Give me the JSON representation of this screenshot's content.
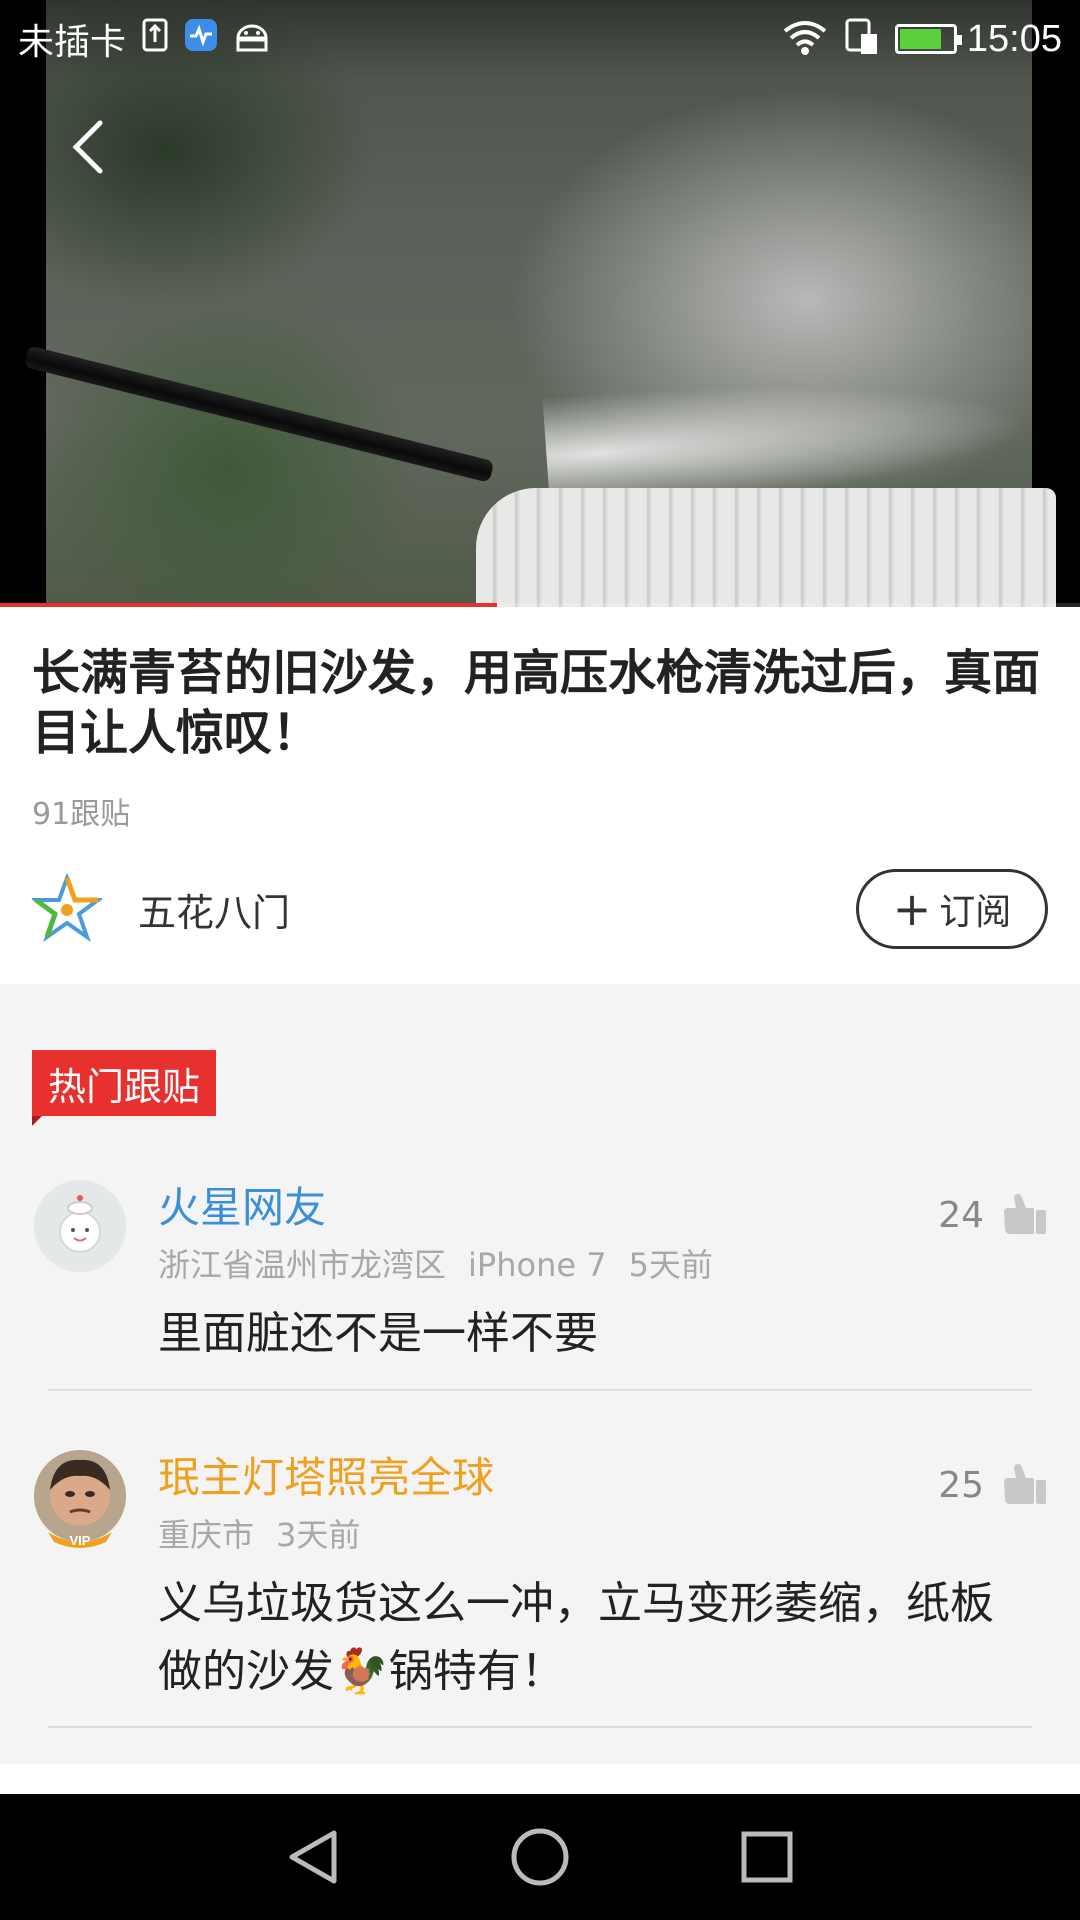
{
  "status_bar": {
    "carrier": "未插卡",
    "time": "15:05",
    "battery_percent": 80,
    "icons": [
      "sim-icon",
      "health-icon",
      "android-icon",
      "wifi-icon",
      "sim-slot-icon",
      "battery-icon"
    ]
  },
  "video": {
    "progress_percent": 46,
    "back_icon": "chevron-left-icon"
  },
  "article": {
    "title": "长满青苔的旧沙发，用高压水枪清洗过后，真面目让人惊叹！",
    "reply_count": "91跟贴",
    "source_name": "五花八门",
    "subscribe_label": "订阅",
    "subscribe_icon": "plus-icon"
  },
  "comments_section": {
    "tag_label": "热门跟贴",
    "tag_color": "#e8312f",
    "items": [
      {
        "username": "火星网友",
        "username_color": "#3b8fd9",
        "location": "浙江省温州市龙湾区",
        "device": "iPhone 7",
        "time": "5天前",
        "likes": "24",
        "text": "里面脏还不是一样不要"
      },
      {
        "username": "珉主灯塔照亮全球",
        "username_color": "#f0a020",
        "location": "重庆市",
        "time": "3天前",
        "likes": "25",
        "text": "义乌垃圾货这么一冲，立马变形萎缩，纸板做的沙发🐓锅特有！",
        "avatar_badge": "VIP"
      }
    ]
  },
  "nav_bar": {
    "buttons": [
      "back-triangle-icon",
      "home-circle-icon",
      "recents-square-icon"
    ]
  }
}
